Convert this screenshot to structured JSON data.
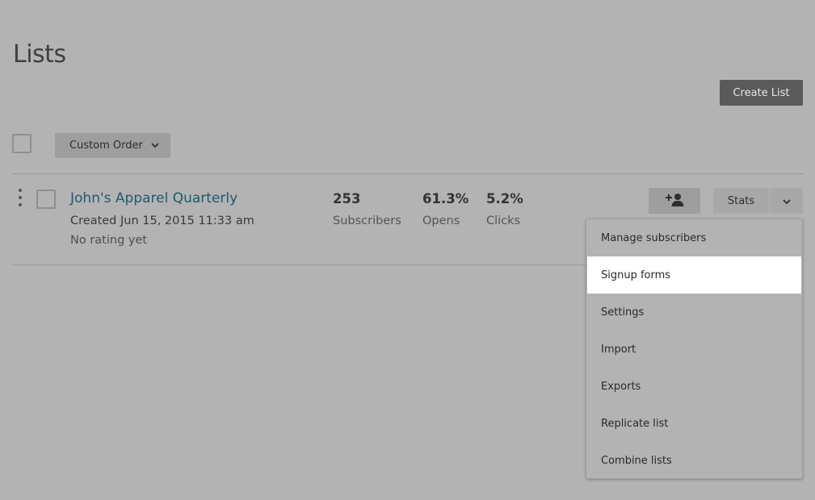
{
  "page": {
    "title": "Lists"
  },
  "toolbar": {
    "create_label": "Create List",
    "sort_label": "Custom Order"
  },
  "list": {
    "name": "John's Apparel Quarterly",
    "created": "Created Jun 15, 2015 11:33 am",
    "rating": "No rating yet",
    "stats": [
      {
        "value": "253",
        "label": "Subscribers"
      },
      {
        "value": "61.3%",
        "label": "Opens"
      },
      {
        "value": "5.2%",
        "label": "Clicks"
      }
    ],
    "stats_button_label": "Stats"
  },
  "menu": {
    "items": [
      {
        "label": "Manage subscribers",
        "active": false
      },
      {
        "label": "Signup forms",
        "active": true
      },
      {
        "label": "Settings",
        "active": false
      },
      {
        "label": "Import",
        "active": false
      },
      {
        "label": "Exports",
        "active": false
      },
      {
        "label": "Replicate list",
        "active": false
      },
      {
        "label": "Combine lists",
        "active": false
      }
    ]
  },
  "icons": {
    "sort_chevron": "chevron-down-icon",
    "add_subscriber": "add-subscriber-icon",
    "stats_chevron": "chevron-down-icon",
    "drag_handle": "drag-handle-icon"
  },
  "colors": {
    "background": "#b3b3b3",
    "link": "#1e5b6e",
    "primary_button": "#5a5a5a",
    "menu_active": "#ffffff"
  }
}
